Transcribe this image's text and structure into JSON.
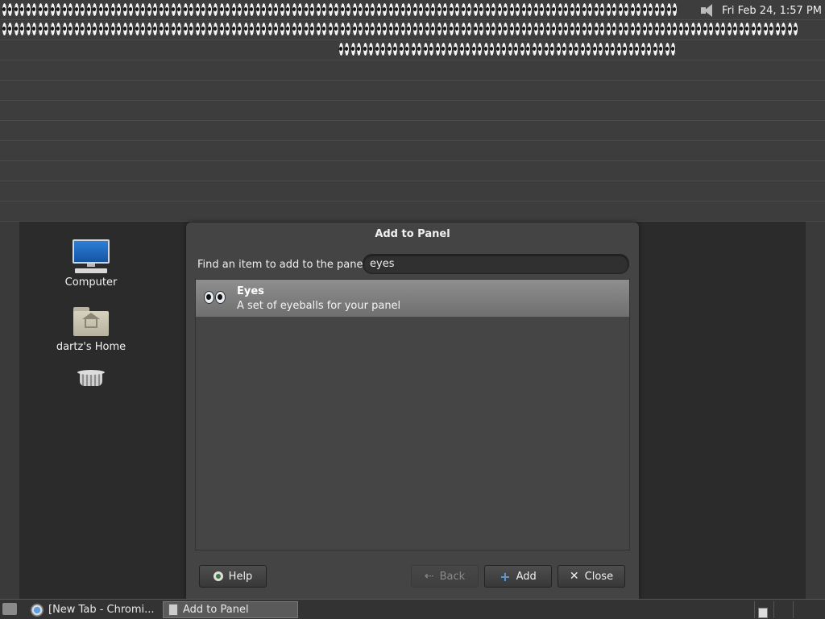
{
  "top_panel": {
    "clock": "Fri Feb 24,  1:57 PM",
    "eyes_row1_count": 56,
    "eyes_row2_count": 66,
    "eyes_row3_count": 28
  },
  "desktop": {
    "icons": [
      {
        "label": "Computer",
        "icon": "computer-icon"
      },
      {
        "label": "dartz's Home",
        "icon": "home-folder-icon"
      },
      {
        "label": "",
        "icon": "trash-icon"
      }
    ]
  },
  "dialog": {
    "title": "Add to Panel",
    "find_label": "Find an item to add to the panel:",
    "search_value": "eyes",
    "results": [
      {
        "name": "Eyes",
        "description": "A set of eyeballs for your panel",
        "icon": "eyes-icon",
        "selected": true
      }
    ],
    "buttons": {
      "help": "Help",
      "back": "Back",
      "add": "Add",
      "close": "Close"
    }
  },
  "taskbar": {
    "tasks": [
      {
        "label": "[New Tab - Chromi...",
        "icon": "chromium-icon"
      },
      {
        "label": "Add to Panel",
        "icon": "window-icon",
        "active": true
      }
    ]
  }
}
